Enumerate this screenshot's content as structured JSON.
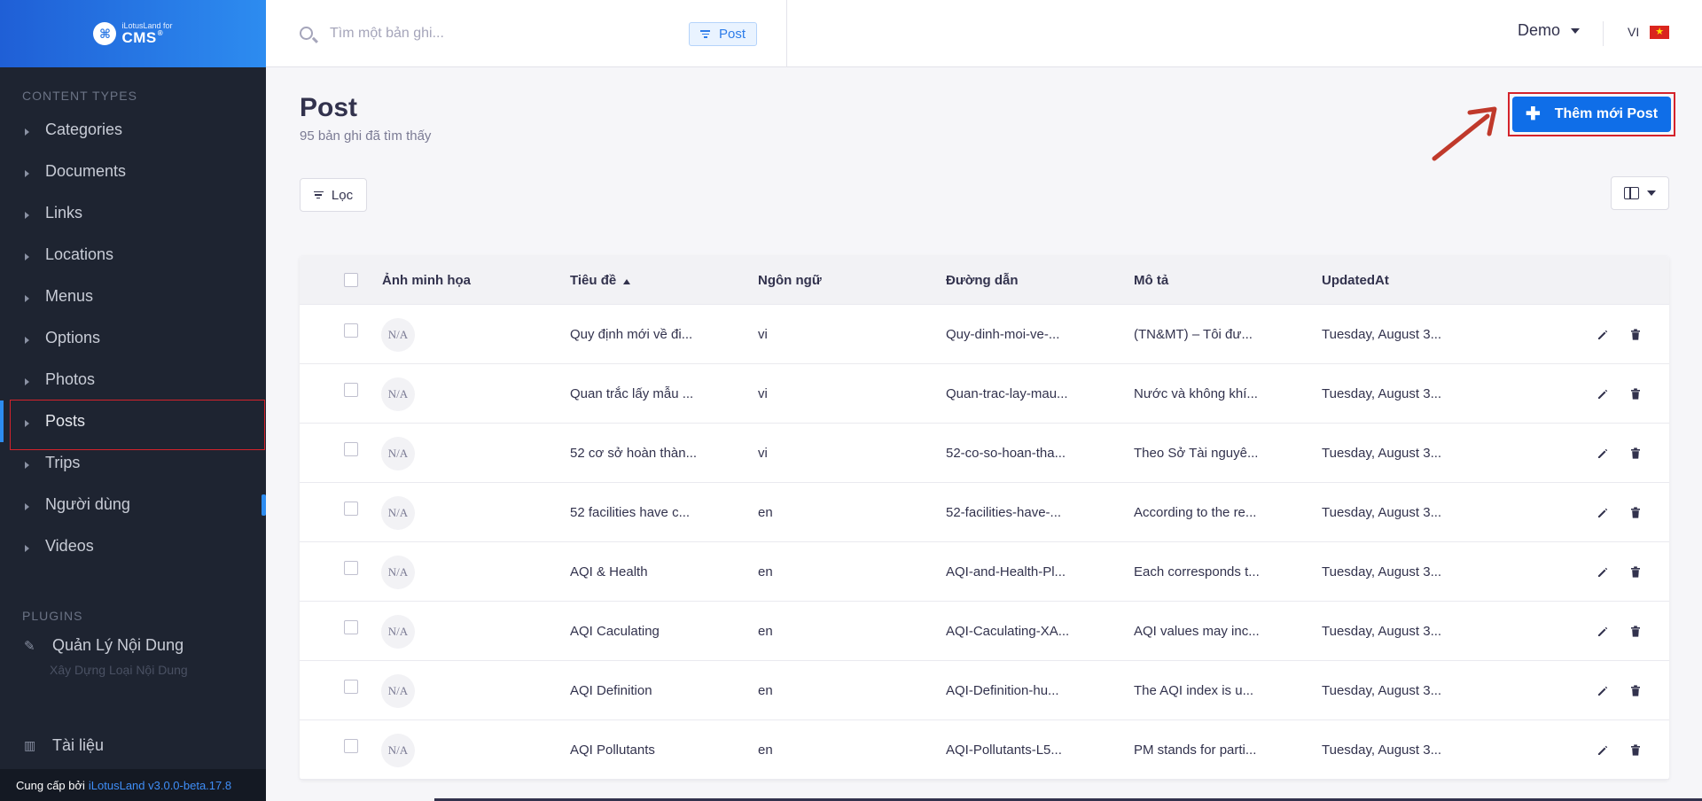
{
  "brand": {
    "small": "iLotusLand for",
    "big": "CMS",
    "reg": "®"
  },
  "sidebar": {
    "content_types_title": "CONTENT TYPES",
    "items": [
      {
        "label": "Categories"
      },
      {
        "label": "Documents"
      },
      {
        "label": "Links"
      },
      {
        "label": "Locations"
      },
      {
        "label": "Menus"
      },
      {
        "label": "Options"
      },
      {
        "label": "Photos"
      },
      {
        "label": "Posts",
        "active": true
      },
      {
        "label": "Trips"
      },
      {
        "label": "Người dùng"
      },
      {
        "label": "Videos"
      }
    ],
    "plugins_title": "PLUGINS",
    "plugin_item": "Quản Lý Nội Dung",
    "plugin_faded": "Xây Dựng Loại Nội Dung",
    "docs_item": "Tài liệu",
    "footer_prefix": "Cung cấp bởi",
    "footer_link": "iLotusLand v3.0.0-beta.17.8"
  },
  "header": {
    "search_placeholder": "Tìm một bản ghi...",
    "chip_label": "Post",
    "user": "Demo",
    "lang": "VI",
    "flag_star": "★"
  },
  "page": {
    "title": "Post",
    "subtitle": "95 bản ghi đã tìm thấy",
    "add_button": "Thêm mới Post",
    "filter_button": "Lọc"
  },
  "table": {
    "headers": {
      "image": "Ảnh minh họa",
      "title": "Tiêu đề",
      "lang": "Ngôn ngữ",
      "path": "Đường dẫn",
      "desc": "Mô tả",
      "updated": "UpdatedAt"
    },
    "na": "N/A",
    "rows": [
      {
        "title": "Quy định mới về đi...",
        "lang": "vi",
        "path": "Quy-dinh-moi-ve-...",
        "desc": "(TN&MT) – Tôi đư...",
        "updated": "Tuesday, August 3..."
      },
      {
        "title": "Quan trắc lấy mẫu ...",
        "lang": "vi",
        "path": "Quan-trac-lay-mau...",
        "desc": "Nước và không khí...",
        "updated": "Tuesday, August 3..."
      },
      {
        "title": "52 cơ sở hoàn thàn...",
        "lang": "vi",
        "path": "52-co-so-hoan-tha...",
        "desc": "Theo Sở Tài nguyê...",
        "updated": "Tuesday, August 3..."
      },
      {
        "title": "52 facilities have c...",
        "lang": "en",
        "path": "52-facilities-have-...",
        "desc": "According to the re...",
        "updated": "Tuesday, August 3..."
      },
      {
        "title": "AQI & Health",
        "lang": "en",
        "path": "AQI-and-Health-Pl...",
        "desc": "Each corresponds t...",
        "updated": "Tuesday, August 3..."
      },
      {
        "title": "AQI Caculating",
        "lang": "en",
        "path": "AQI-Caculating-XA...",
        "desc": "AQI values may inc...",
        "updated": "Tuesday, August 3..."
      },
      {
        "title": "AQI Definition",
        "lang": "en",
        "path": "AQI-Definition-hu...",
        "desc": "The AQI index is u...",
        "updated": "Tuesday, August 3..."
      },
      {
        "title": "AQI Pollutants",
        "lang": "en",
        "path": "AQI-Pollutants-L5...",
        "desc": "PM stands for parti...",
        "updated": "Tuesday, August 3..."
      }
    ]
  },
  "colors": {
    "accent": "#0f6ee8",
    "sidebar_bg": "#1e2431",
    "highlight": "#d4232b",
    "arrow": "#c0392b"
  }
}
